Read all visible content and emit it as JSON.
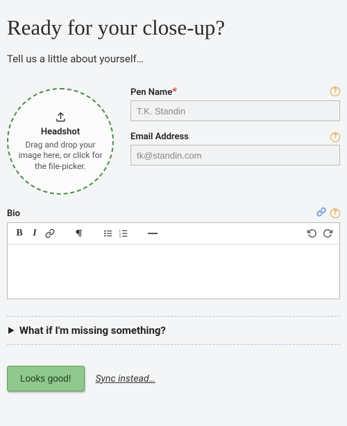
{
  "heading": "Ready for your close-up?",
  "subtitle": "Tell us a little about yourself…",
  "headshot": {
    "title": "Headshot",
    "instructions": "Drag and drop your image here, or click for the file-picker."
  },
  "fields": {
    "pen_name": {
      "label": "Pen Name",
      "required_mark": "*",
      "placeholder": "T.K. Standin",
      "value": ""
    },
    "email": {
      "label": "Email Address",
      "placeholder": "tk@standin.com",
      "value": ""
    },
    "bio": {
      "label": "Bio",
      "value": ""
    }
  },
  "toolbar": {
    "bold": "B",
    "italic": "I"
  },
  "faq_summary": "What if I'm missing something?",
  "actions": {
    "primary": "Looks good!",
    "sync": "Sync instead…"
  }
}
